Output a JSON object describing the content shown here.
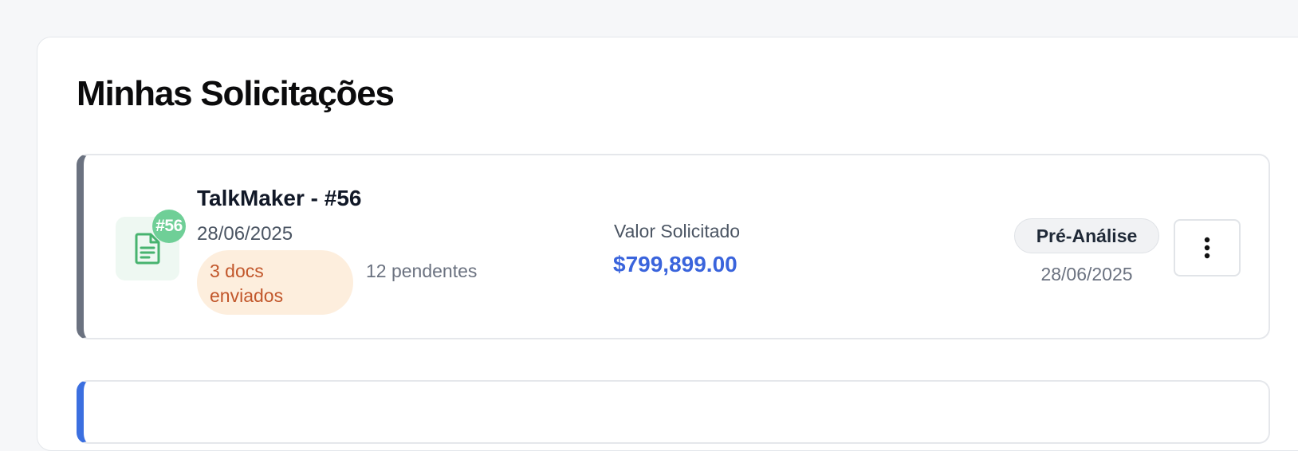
{
  "page": {
    "title": "Minhas Solicitações"
  },
  "requests": [
    {
      "title": "TalkMaker - #56",
      "badge": "#56",
      "date": "28/06/2025",
      "docs_sent": "3 docs enviados",
      "pending": "12 pendentes",
      "amount_label": "Valor Solicitado",
      "amount": "$799,899.00",
      "status": "Pré-Análise",
      "status_date": "28/06/2025",
      "icon": "file-document-icon",
      "more_icon": "more-vertical-icon",
      "accent_color": "#6b7280"
    }
  ],
  "colors": {
    "amount": "#3a64dc",
    "file_badge": "#6fcf97",
    "docs_pill_bg": "#fdeedd",
    "docs_pill_text": "#c2572b",
    "next_card_accent": "#3b6fe0"
  }
}
